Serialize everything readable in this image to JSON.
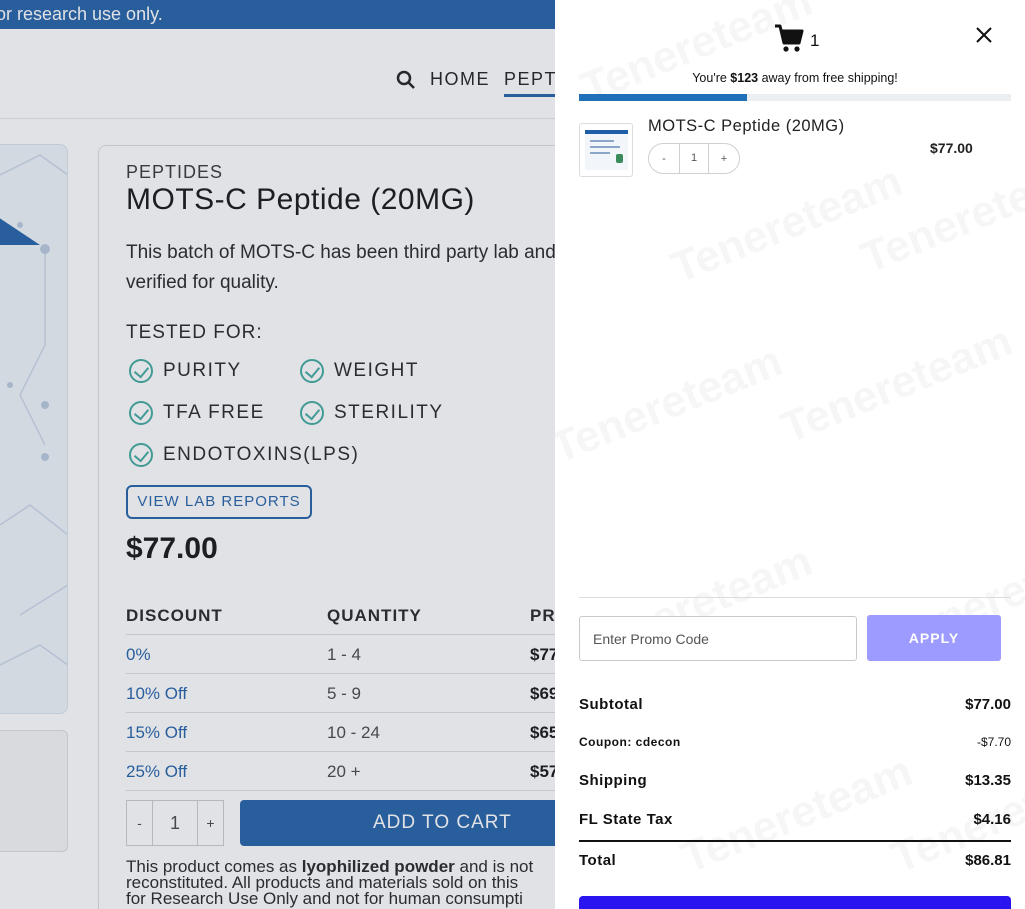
{
  "background": {
    "topbar_text": "or research use only.",
    "nav": {
      "home": "HOME",
      "peptides": "PEPT"
    },
    "product": {
      "category": "PEPTIDES",
      "title": "MOTS-C Peptide (20MG)",
      "description": "This batch of MOTS-C has been third party lab and verified for quality.",
      "tested_for_label": "TESTED FOR:",
      "tests": [
        "PURITY",
        "WEIGHT",
        "TFA FREE",
        "STERILITY",
        "ENDOTOXINS(LPS)"
      ],
      "lab_button": "VIEW LAB REPORTS",
      "price": "$77.00",
      "discount_table": {
        "headers": [
          "DISCOUNT",
          "QUANTITY",
          "PR"
        ],
        "rows": [
          [
            "0%",
            "1 - 4",
            "$77"
          ],
          [
            "10% Off",
            "5 - 9",
            "$69"
          ],
          [
            "15% Off",
            "10 - 24",
            "$65"
          ],
          [
            "25% Off",
            "20 +",
            "$57"
          ]
        ]
      },
      "qty": {
        "minus": "-",
        "value": "1",
        "plus": "+"
      },
      "add_to_cart": "ADD TO CART",
      "note_html": [
        "This product comes as ",
        "lyophilized powder",
        " and is not",
        "reconstituted. All products and materials sold on this",
        "for Research Use Only and not for human consumpti"
      ]
    }
  },
  "cart": {
    "count": "1",
    "shipping_msg": {
      "pre": "You're ",
      "amount": "$123",
      "post": " away from free shipping!"
    },
    "progress": 0.39,
    "watermark": "Tenereteam",
    "item": {
      "name": "MOTS-C Peptide (20MG)",
      "qty_minus": "-",
      "qty": "1",
      "qty_plus": "+",
      "price": "$77.00"
    },
    "promo_placeholder": "Enter Promo Code",
    "apply_label": "APPLY",
    "summary": {
      "subtotal_label": "Subtotal",
      "subtotal": "$77.00",
      "coupon_label": "Coupon: cdecon",
      "coupon": "-$7.70",
      "shipping_label": "Shipping",
      "shipping": "$13.35",
      "tax_label": "FL State Tax",
      "tax": "$4.16",
      "total_label": "Total",
      "total": "$86.81"
    },
    "colors": {
      "progress": "#1f6fb9",
      "apply": "#9d9bff",
      "checkout": "#2a14f0",
      "brand": "#1f5fa8"
    },
    "icons": {
      "cart": "cart-icon",
      "close": "close-icon"
    }
  }
}
